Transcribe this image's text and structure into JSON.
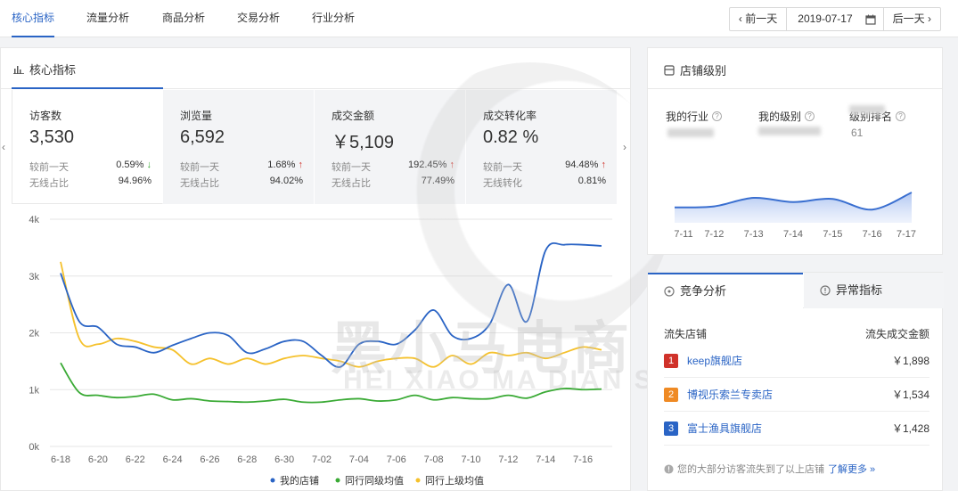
{
  "nav": {
    "tabs": [
      "核心指标",
      "流量分析",
      "商品分析",
      "交易分析",
      "行业分析"
    ],
    "prev_day": "‹ 前一天",
    "date": "2019-07-17",
    "next_day": "后一天 ›"
  },
  "main": {
    "title": "核心指标",
    "cards": [
      {
        "label": "访客数",
        "value": "3,530",
        "r1_label": "较前一天",
        "r1_value": "0.59%",
        "r1_dir": "↓",
        "r2_label": "无线占比",
        "r2_value": "94.96%"
      },
      {
        "label": "浏览量",
        "value": "6,592",
        "r1_label": "较前一天",
        "r1_value": "1.68%",
        "r1_dir": "↑",
        "r2_label": "无线占比",
        "r2_value": "94.02%"
      },
      {
        "label": "成交金额",
        "value": "￥5,109",
        "r1_label": "较前一天",
        "r1_value": "192.45%",
        "r1_dir": "↑",
        "r2_label": "无线占比",
        "r2_value": "77.49%"
      },
      {
        "label": "成交转化率",
        "value": "0.82 %",
        "r1_label": "较前一天",
        "r1_value": "94.48%",
        "r1_dir": "↑",
        "r2_label": "无线转化",
        "r2_value": "0.81%"
      }
    ]
  },
  "chart_data": [
    {
      "type": "line",
      "x": [
        "6-18",
        "6-19",
        "6-20",
        "6-21",
        "6-22",
        "6-23",
        "6-24",
        "6-25",
        "6-26",
        "6-27",
        "6-28",
        "6-29",
        "6-30",
        "7-01",
        "7-02",
        "7-03",
        "7-04",
        "7-05",
        "7-06",
        "7-07",
        "7-08",
        "7-09",
        "7-10",
        "7-11",
        "7-12",
        "7-13",
        "7-14",
        "7-15",
        "7-16",
        "7-17"
      ],
      "x_tick_labels": [
        "6-18",
        "6-20",
        "6-22",
        "6-24",
        "6-26",
        "6-28",
        "6-30",
        "7-02",
        "7-04",
        "7-06",
        "7-08",
        "7-10",
        "7-12",
        "7-14",
        "7-16"
      ],
      "y_ticks": [
        "0k",
        "1k",
        "2k",
        "3k",
        "4k"
      ],
      "ylim": [
        0,
        4000
      ],
      "grid": true,
      "legend_position": "bottom",
      "series": [
        {
          "name": "我的店铺",
          "color": "#2a64c5",
          "values": [
            3050,
            2200,
            2100,
            1800,
            1750,
            1650,
            1780,
            1900,
            2000,
            1950,
            1650,
            1720,
            1850,
            1850,
            1600,
            1400,
            1800,
            1850,
            1800,
            2050,
            2400,
            1950,
            1900,
            2150,
            2850,
            2200,
            3450,
            3550,
            3550,
            3530
          ]
        },
        {
          "name": "同行同级均值",
          "color": "#3aaa35",
          "values": [
            1470,
            950,
            900,
            860,
            880,
            920,
            820,
            840,
            800,
            790,
            780,
            800,
            830,
            780,
            780,
            820,
            840,
            800,
            820,
            900,
            820,
            860,
            840,
            840,
            900,
            850,
            960,
            1020,
            1000,
            1010
          ]
        },
        {
          "name": "同行上级均值",
          "color": "#f5c12c",
          "values": [
            3250,
            1900,
            1800,
            1900,
            1850,
            1750,
            1700,
            1450,
            1550,
            1450,
            1550,
            1450,
            1550,
            1600,
            1550,
            1500,
            1400,
            1500,
            1550,
            1550,
            1400,
            1600,
            1450,
            1650,
            1600,
            1650,
            1550,
            1650,
            1750,
            1700
          ]
        }
      ]
    },
    {
      "type": "area",
      "x": [
        "7-11",
        "7-12",
        "7-13",
        "7-14",
        "7-15",
        "7-16",
        "7-17"
      ],
      "values": [
        0.3,
        0.35,
        0.75,
        0.55,
        0.7,
        0.2,
        1.0
      ],
      "color": "#3a6fd0"
    }
  ],
  "level": {
    "title": "店铺级别",
    "cols": [
      "我的行业",
      "我的级别",
      "级别排名"
    ],
    "rank_value": "61"
  },
  "compete": {
    "tab_active": "竞争分析",
    "tab_other": "异常指标",
    "col_left": "流失店铺",
    "col_right": "流失成交金额",
    "rows": [
      {
        "rank": "1",
        "color": "#d0322a",
        "shop": "keep旗舰店",
        "amount": "￥1,898"
      },
      {
        "rank": "2",
        "color": "#ef8a24",
        "shop": "博视乐索兰专卖店",
        "amount": "￥1,534"
      },
      {
        "rank": "3",
        "color": "#2a64c5",
        "shop": "富士渔具旗舰店",
        "amount": "￥1,428"
      }
    ],
    "tip_text": "您的大部分访客流失到了以上店铺",
    "tip_link": "了解更多 »"
  },
  "watermark": {
    "line1": "黑小马电商",
    "line2": "HEI XIAO MA DIAN SHANG"
  }
}
